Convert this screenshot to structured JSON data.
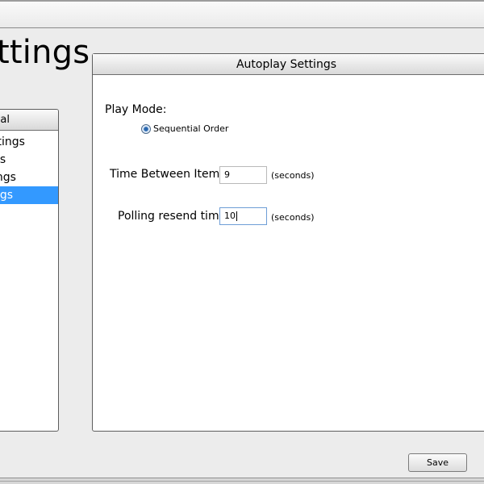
{
  "page": {
    "title": "ttings"
  },
  "left_panel": {
    "header": "al",
    "items": [
      {
        "label": "ttings",
        "selected": false
      },
      {
        "label": "gs",
        "selected": false
      },
      {
        "label": "ings",
        "selected": false
      },
      {
        "label": "ngs",
        "selected": true
      }
    ],
    "selected_color": "#3399ff"
  },
  "autoplay": {
    "header": "Autoplay Settings",
    "play_mode_label": "Play Mode:",
    "play_mode_option": "Sequential Order",
    "play_mode_selected": true,
    "time_between_label": "Time Between Items:",
    "time_between_value": "9",
    "time_between_unit": "(seconds)",
    "polling_label": "Polling resend time:",
    "polling_value": "10",
    "polling_unit": "(seconds)"
  },
  "footer": {
    "save_label": "Save"
  }
}
